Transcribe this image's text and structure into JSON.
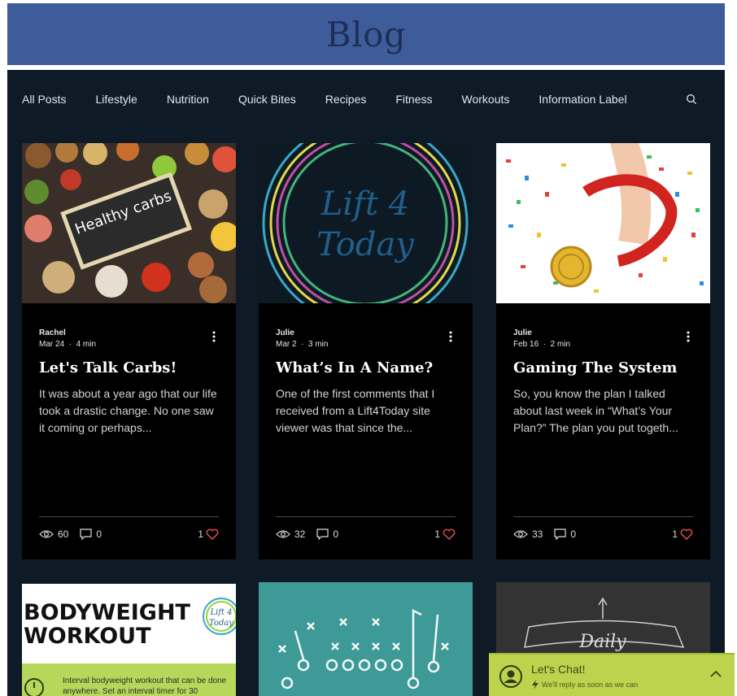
{
  "header": {
    "title": "Blog"
  },
  "nav": {
    "categories": [
      "All Posts",
      "Lifestyle",
      "Nutrition",
      "Quick Bites",
      "Recipes",
      "Fitness",
      "Workouts",
      "Information Label"
    ]
  },
  "posts": [
    {
      "author": "Rachel",
      "date": "Mar 24",
      "read_time": "4 min",
      "title": "Let's Talk Carbs!",
      "excerpt": "It was about a year ago that our life took a drastic change. No one saw it coming or perhaps...",
      "views": "60",
      "comments": "0",
      "likes": "1",
      "image_label": "Healthy carbs"
    },
    {
      "author": "Julie",
      "date": "Mar 2",
      "read_time": "3 min",
      "title": "What’s In A Name?",
      "excerpt": "One of the first comments that I received from a Lift4Today site viewer was that since the...",
      "views": "32",
      "comments": "0",
      "likes": "1",
      "image_label_1": "Lift 4",
      "image_label_2": "Today"
    },
    {
      "author": "Julie",
      "date": "Feb 16",
      "read_time": "2 min",
      "title": "Gaming The System",
      "excerpt": "So, you know the plan I talked about last week in “What’s Your Plan?” The plan you put togeth...",
      "views": "33",
      "comments": "0",
      "likes": "1"
    }
  ],
  "row2": {
    "card1": {
      "heading_1": "BODYWEIGHT",
      "heading_2": "WORKOUT",
      "logo_1": "Lift 4",
      "logo_2": "Today",
      "body": "Interval bodyweight workout that can be done anywhere.  Set an interval timer for 30"
    },
    "card3": {
      "label": "Daily"
    }
  },
  "chat": {
    "title": "Let's Chat!",
    "subtitle": "We'll reply as soon as we can"
  },
  "colors": {
    "header_bg": "#3f5c9a",
    "main_bg": "#0e1b26",
    "card_bg": "#000000",
    "like_heart": "#e8514a",
    "chat_bg": "#bdd34d"
  }
}
